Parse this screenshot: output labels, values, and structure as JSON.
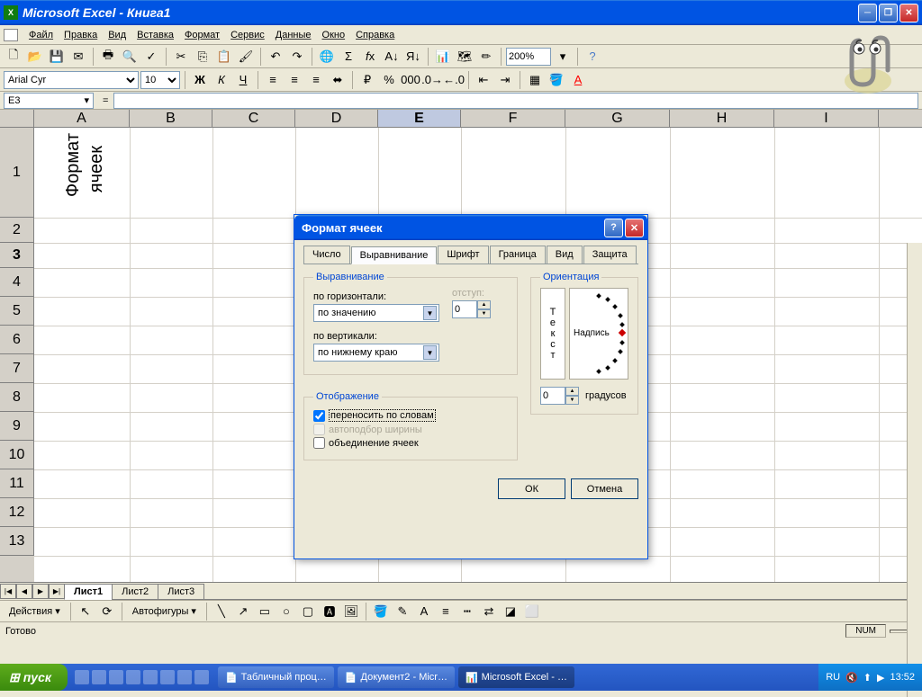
{
  "titlebar": {
    "title": "Microsoft Excel - Книга1"
  },
  "menu": {
    "file": "Файл",
    "edit": "Правка",
    "view": "Вид",
    "insert": "Вставка",
    "format": "Формат",
    "tools": "Сервис",
    "data": "Данные",
    "window": "Окно",
    "help": "Справка"
  },
  "font": {
    "name": "Arial Cyr",
    "size": "10"
  },
  "format_btns": {
    "bold": "Ж",
    "italic": "К",
    "underline": "Ч"
  },
  "zoom": "200%",
  "namebox": "E3",
  "columns": [
    "A",
    "B",
    "C",
    "D",
    "E",
    "F",
    "G",
    "H",
    "I"
  ],
  "active_col": "E",
  "rows": [
    "1",
    "2",
    "3",
    "4",
    "5",
    "6",
    "7",
    "8",
    "9",
    "10",
    "11",
    "12",
    "13"
  ],
  "active_row": "3",
  "cell_a1_l1": "Формат",
  "cell_a1_l2": "ячеек",
  "sheets": {
    "s1": "Лист1",
    "s2": "Лист2",
    "s3": "Лист3"
  },
  "draw": {
    "actions": "Действия",
    "autoshapes": "Автофигуры"
  },
  "status": {
    "ready": "Готово",
    "num": "NUM"
  },
  "taskbar": {
    "start": "пуск",
    "task1": "Табличный проц…",
    "task2": "Документ2 - Micr…",
    "task3": "Microsoft Excel - …",
    "lang": "RU",
    "time": "13:52"
  },
  "dialog": {
    "title": "Формат ячеек",
    "tabs": {
      "number": "Число",
      "align": "Выравнивание",
      "font": "Шрифт",
      "border": "Граница",
      "pattern": "Вид",
      "protect": "Защита"
    },
    "align_group": "Выравнивание",
    "horiz_label": "по горизонтали:",
    "horiz_value": "по значению",
    "indent_label": "отступ:",
    "indent_value": "0",
    "vert_label": "по вертикали:",
    "vert_value": "по нижнему краю",
    "display_group": "Отображение",
    "wrap": "переносить по словам",
    "shrink": "автоподбор ширины",
    "merge": "объединение ячеек",
    "orient_group": "Ориентация",
    "orient_text": "Текст",
    "orient_inscription": "Надпись",
    "degrees_value": "0",
    "degrees_label": "градусов",
    "ok": "ОК",
    "cancel": "Отмена"
  }
}
